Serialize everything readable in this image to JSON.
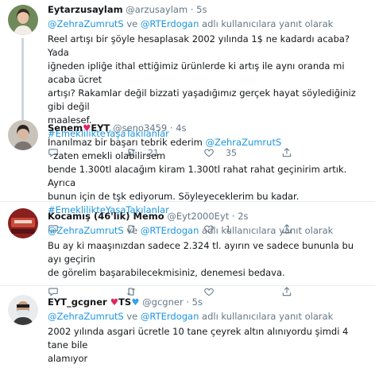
{
  "tweets": [
    {
      "name": "Eytarzusaylam",
      "handle": "@arzusaylam",
      "dot": "·",
      "time": "5s",
      "replying_to_1": "@ZehraZumrutS",
      "replying_and": " ve ",
      "replying_to_2": "@RTErdogan",
      "replying_suffix": " adlı kullanıcılara yanıt olarak",
      "lines": [
        "Reel artışı bir şöyle hesaplasak 2002 yılında 1$ ne kadardı acaba? Yada",
        "iğneden ipliğe ithal ettiğimiz ürünlerde ki artış ile aynı oranda mi acaba ücret",
        "artışı? Rakamlar değil bizzati yaşadığımız gerçek hayat söylediğiniz gibi değil",
        "maalesef."
      ],
      "hashtag": "#EmeklilikteYaşaTakılanlar",
      "replies": "",
      "retweets": "21",
      "likes": "35"
    },
    {
      "name": "Senem",
      "name_heart": "♥",
      "name_suffix": "EYT",
      "handle": "@seno3459",
      "dot": "·",
      "time": "4s",
      "lines_parts": {
        "l1_pre": "İnanılmaz bir başarı tebrik ederim ",
        "l1_mention": "@ZehraZumrutS",
        "l1_post": "  zaten emekli olabilirsem",
        "l2": "bende 1.300tl alacağım kiram 1.300tl rahat rahat geçinirim artık. Ayrıca",
        "l3": "bunun için de tşk ediyorum. Söyleyeceklerim bu kadar."
      },
      "hashtag": "#EmeklilikteYaşaTakılanlar",
      "replies": "",
      "retweets": "",
      "likes": "1"
    },
    {
      "name": "Kocamış (46'lık) Memo",
      "handle": "@Eyt2000Eyt",
      "dot": "·",
      "time": "2s",
      "replying_to_1": "@ZehraZumrutS",
      "replying_and": " ve ",
      "replying_to_2": "@RTErdogan",
      "replying_suffix": " adlı kullanıcılara yanıt olarak",
      "lines": [
        "Bu ay ki maaşınızdan sadece 2.324 tl. ayırın ve sadece bununla bu ayı geçirin",
        "de görelim başarabilecekmisiniz, denemesi bedava."
      ],
      "replies": "",
      "retweets": "",
      "likes": ""
    },
    {
      "name": "EYT_gcgner",
      "name_heart": "♥",
      "name_mid": "TS",
      "name_heart2": "♥",
      "handle": "@gcgner",
      "dot": "·",
      "time": "5s",
      "replying_to_1": "@ZehraZumrutS",
      "replying_and": " ve ",
      "replying_to_2": "@RTErdogan",
      "replying_suffix": " adlı kullanıcılara yanıt olarak",
      "lines": [
        "2002 yılında asgari ücretle 10 tane çeyrek altın alınıyordu şimdi 4 tane bile",
        "alamıyor"
      ]
    }
  ],
  "icons": {
    "reply": "reply-icon",
    "retweet": "retweet-icon",
    "like": "like-icon",
    "share": "share-icon"
  },
  "colors": {
    "link": "#1b95e0",
    "muted": "#657786",
    "divider": "#e6ecf0",
    "heart": "#e0245e"
  }
}
